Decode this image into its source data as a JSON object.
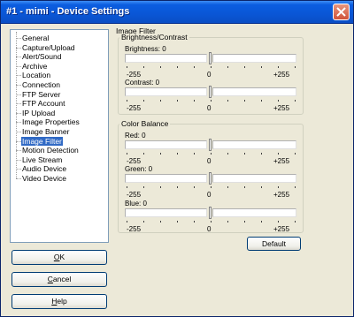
{
  "window": {
    "title": "#1 - mimi - Device Settings"
  },
  "sidebar": {
    "items": [
      {
        "label": "General",
        "selected": false
      },
      {
        "label": "Capture/Upload",
        "selected": false
      },
      {
        "label": "Alert/Sound",
        "selected": false
      },
      {
        "label": "Archive",
        "selected": false
      },
      {
        "label": "Location",
        "selected": false
      },
      {
        "label": "Connection",
        "selected": false
      },
      {
        "label": "FTP Server",
        "selected": false
      },
      {
        "label": "FTP Account",
        "selected": false
      },
      {
        "label": "IP Upload",
        "selected": false
      },
      {
        "label": "Image Properties",
        "selected": false
      },
      {
        "label": "Image Banner",
        "selected": false
      },
      {
        "label": "Image Filter",
        "selected": true
      },
      {
        "label": "Motion Detection",
        "selected": false
      },
      {
        "label": "Live Stream",
        "selected": false
      },
      {
        "label": "Audio Device",
        "selected": false
      },
      {
        "label": "Video Device",
        "selected": false
      }
    ]
  },
  "buttons": {
    "ok": {
      "accel": "O",
      "rest": "K"
    },
    "cancel": {
      "accel": "C",
      "rest": "ancel"
    },
    "help": {
      "accel": "H",
      "rest": "elp"
    },
    "default": "Default"
  },
  "panel": {
    "title": "Image Filter",
    "brightness_contrast": {
      "legend": "Brightness/Contrast",
      "sliders": [
        {
          "label": "Brightness: 0",
          "min": "-255",
          "mid": "0",
          "max": "+255",
          "value": 0
        },
        {
          "label": "Contrast: 0",
          "min": "-255",
          "mid": "0",
          "max": "+255",
          "value": 0
        }
      ]
    },
    "color_balance": {
      "legend": "Color Balance",
      "sliders": [
        {
          "label": "Red: 0",
          "min": "-255",
          "mid": "0",
          "max": "+255",
          "value": 0
        },
        {
          "label": "Green: 0",
          "min": "-255",
          "mid": "0",
          "max": "+255",
          "value": 0
        },
        {
          "label": "Blue: 0",
          "min": "-255",
          "mid": "0",
          "max": "+255",
          "value": 0
        }
      ]
    }
  },
  "colors": {
    "titlebar": "#0a56d6",
    "selection": "#316ac5",
    "dialog_bg": "#ece9d8"
  }
}
